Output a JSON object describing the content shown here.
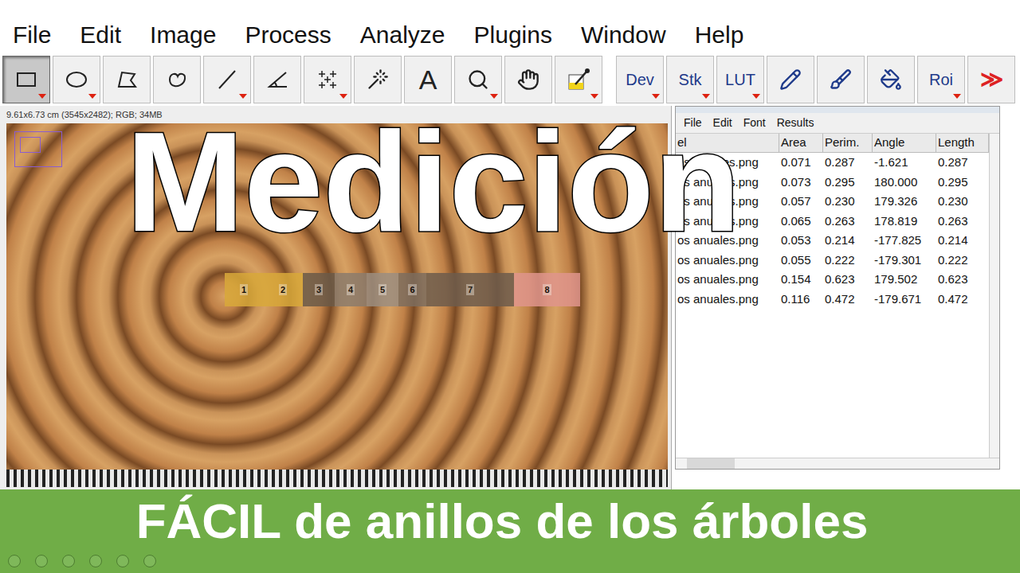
{
  "menubar": [
    "File",
    "Edit",
    "Image",
    "Process",
    "Analyze",
    "Plugins",
    "Window",
    "Help"
  ],
  "toolbar": {
    "tools": [
      {
        "kind": "icon",
        "selected": true,
        "menu": true
      },
      {
        "kind": "icon",
        "selected": false,
        "menu": true
      },
      {
        "kind": "icon",
        "selected": false,
        "menu": false
      },
      {
        "kind": "icon",
        "selected": false,
        "menu": false
      },
      {
        "kind": "icon",
        "selected": false,
        "menu": true
      },
      {
        "kind": "icon",
        "selected": false,
        "menu": false
      },
      {
        "kind": "icon",
        "selected": false,
        "menu": true
      },
      {
        "kind": "icon",
        "selected": false,
        "menu": false
      },
      {
        "kind": "text",
        "label": "A",
        "selected": false,
        "menu": false
      },
      {
        "kind": "icon",
        "selected": false,
        "menu": true
      },
      {
        "kind": "icon",
        "selected": false,
        "menu": false
      },
      {
        "kind": "icon",
        "selected": false,
        "menu": true
      }
    ],
    "extras": [
      {
        "kind": "text",
        "label": "Dev",
        "selected": false,
        "menu": true
      },
      {
        "kind": "text",
        "label": "Stk",
        "selected": false,
        "menu": true
      },
      {
        "kind": "text",
        "label": "LUT",
        "selected": false,
        "menu": true
      },
      {
        "kind": "icon",
        "selected": false,
        "menu": false
      },
      {
        "kind": "icon",
        "selected": false,
        "menu": false
      },
      {
        "kind": "icon",
        "selected": false,
        "menu": false
      },
      {
        "kind": "text",
        "label": "Roi",
        "selected": false,
        "menu": true
      },
      {
        "kind": "text",
        "label": "≫",
        "selected": false,
        "menu": false
      }
    ]
  },
  "image_window": {
    "status": "9.61x6.73 cm (3545x2482); RGB; 34MB",
    "markers": [
      {
        "label": "1",
        "color": "#d9a93a"
      },
      {
        "label": "2",
        "color": "#d9a93a"
      },
      {
        "label": "3",
        "color": "#6b5a48"
      },
      {
        "label": "4",
        "color": "#8c7c6c"
      },
      {
        "label": "5",
        "color": "#9c8e80"
      },
      {
        "label": "6",
        "color": "#7d6d5e"
      },
      {
        "label": "7",
        "color": "#6e5c4c"
      },
      {
        "label": "8",
        "color": "#e0958c"
      }
    ]
  },
  "results": {
    "menu": [
      "File",
      "Edit",
      "Font",
      "Results"
    ],
    "columns": [
      "el",
      "Area",
      "Perim.",
      "Angle",
      "Length"
    ],
    "rows": [
      [
        "os anuales.png",
        "0.071",
        "0.287",
        "-1.621",
        "0.287"
      ],
      [
        "os anuales.png",
        "0.073",
        "0.295",
        "180.000",
        "0.295"
      ],
      [
        "os anuales.png",
        "0.057",
        "0.230",
        "179.326",
        "0.230"
      ],
      [
        "os anuales.png",
        "0.065",
        "0.263",
        "178.819",
        "0.263"
      ],
      [
        "os anuales.png",
        "0.053",
        "0.214",
        "-177.825",
        "0.214"
      ],
      [
        "os anuales.png",
        "0.055",
        "0.222",
        "-179.301",
        "0.222"
      ],
      [
        "os anuales.png",
        "0.154",
        "0.623",
        "179.502",
        "0.623"
      ],
      [
        "os anuales.png",
        "0.116",
        "0.472",
        "-179.671",
        "0.472"
      ]
    ]
  },
  "overlay_title": "Medición",
  "banner": "FÁCIL de anillos de los árboles"
}
